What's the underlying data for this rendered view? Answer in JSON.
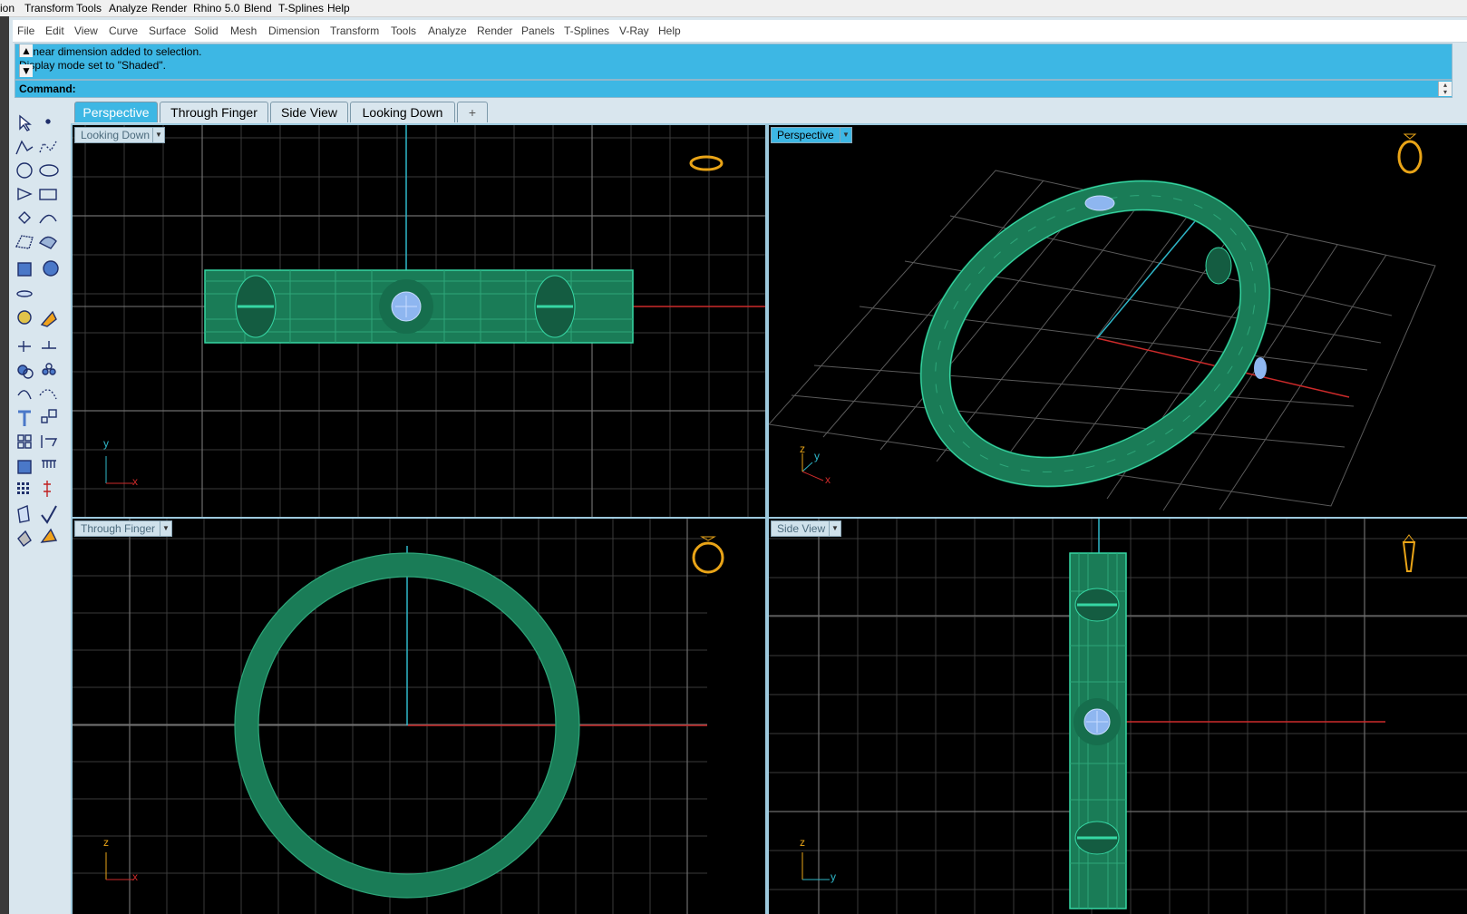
{
  "top_menu": [
    "ion",
    "Transform",
    "Tools",
    "Analyze",
    "Render",
    "Rhino 5.0",
    "Blend",
    "T-Splines",
    "Help"
  ],
  "main_menu": [
    "File",
    "Edit",
    "View",
    "Curve",
    "Surface",
    "Solid",
    "Mesh",
    "Dimension",
    "Transform",
    "Tools",
    "Analyze",
    "Render",
    "Panels",
    "T-Splines",
    "V-Ray",
    "Help"
  ],
  "history": {
    "line1": "1 linear dimension added to selection.",
    "line2": "Display mode set to \"Shaded\"."
  },
  "command": {
    "label": "Command:"
  },
  "tabs": [
    {
      "label": "Perspective",
      "active": true
    },
    {
      "label": "Through Finger",
      "active": false
    },
    {
      "label": "Side View",
      "active": false
    },
    {
      "label": "Looking Down",
      "active": false
    }
  ],
  "add_tab": "+",
  "viewports": {
    "top_left": {
      "label": "Looking Down",
      "axis1": "y",
      "axis2": "x"
    },
    "top_right": {
      "label": "Perspective",
      "axis1": "y",
      "axis2": "x",
      "axis3": "z"
    },
    "bottom_left": {
      "label": "Through Finger",
      "axis1": "z",
      "axis2": "x"
    },
    "bottom_right": {
      "label": "Side View",
      "axis1": "z",
      "axis2": "y"
    }
  },
  "tools": [
    "select-arrow",
    "point",
    "polyline",
    "curve-points",
    "circle",
    "ellipse",
    "polygon",
    "rectangle",
    "hexagon",
    "arc-fillet",
    "control-points",
    "surface-loft",
    "box",
    "sphere",
    "cylinder-extrude",
    "planar-surface",
    "explode-gear",
    "edit-sparkle",
    "trim",
    "split",
    "boolean",
    "array-spheres",
    "curve-fillet",
    "offset",
    "text-t",
    "scale",
    "grid-group",
    "align",
    "solid-cube",
    "dimension-ruler",
    "array-grid",
    "history",
    "surface-edit",
    "checkmark",
    "render-shape",
    "render-tools"
  ],
  "colors": {
    "ring": "#1a7c57",
    "ring_line": "#36d7a4",
    "gem": "#8eb6f0",
    "grid": "#6e6e6e",
    "x_axis": "#cc2a2a",
    "y_axis": "#2fb7c9",
    "accent": "#3db7e4",
    "widget": "#e9a417"
  }
}
